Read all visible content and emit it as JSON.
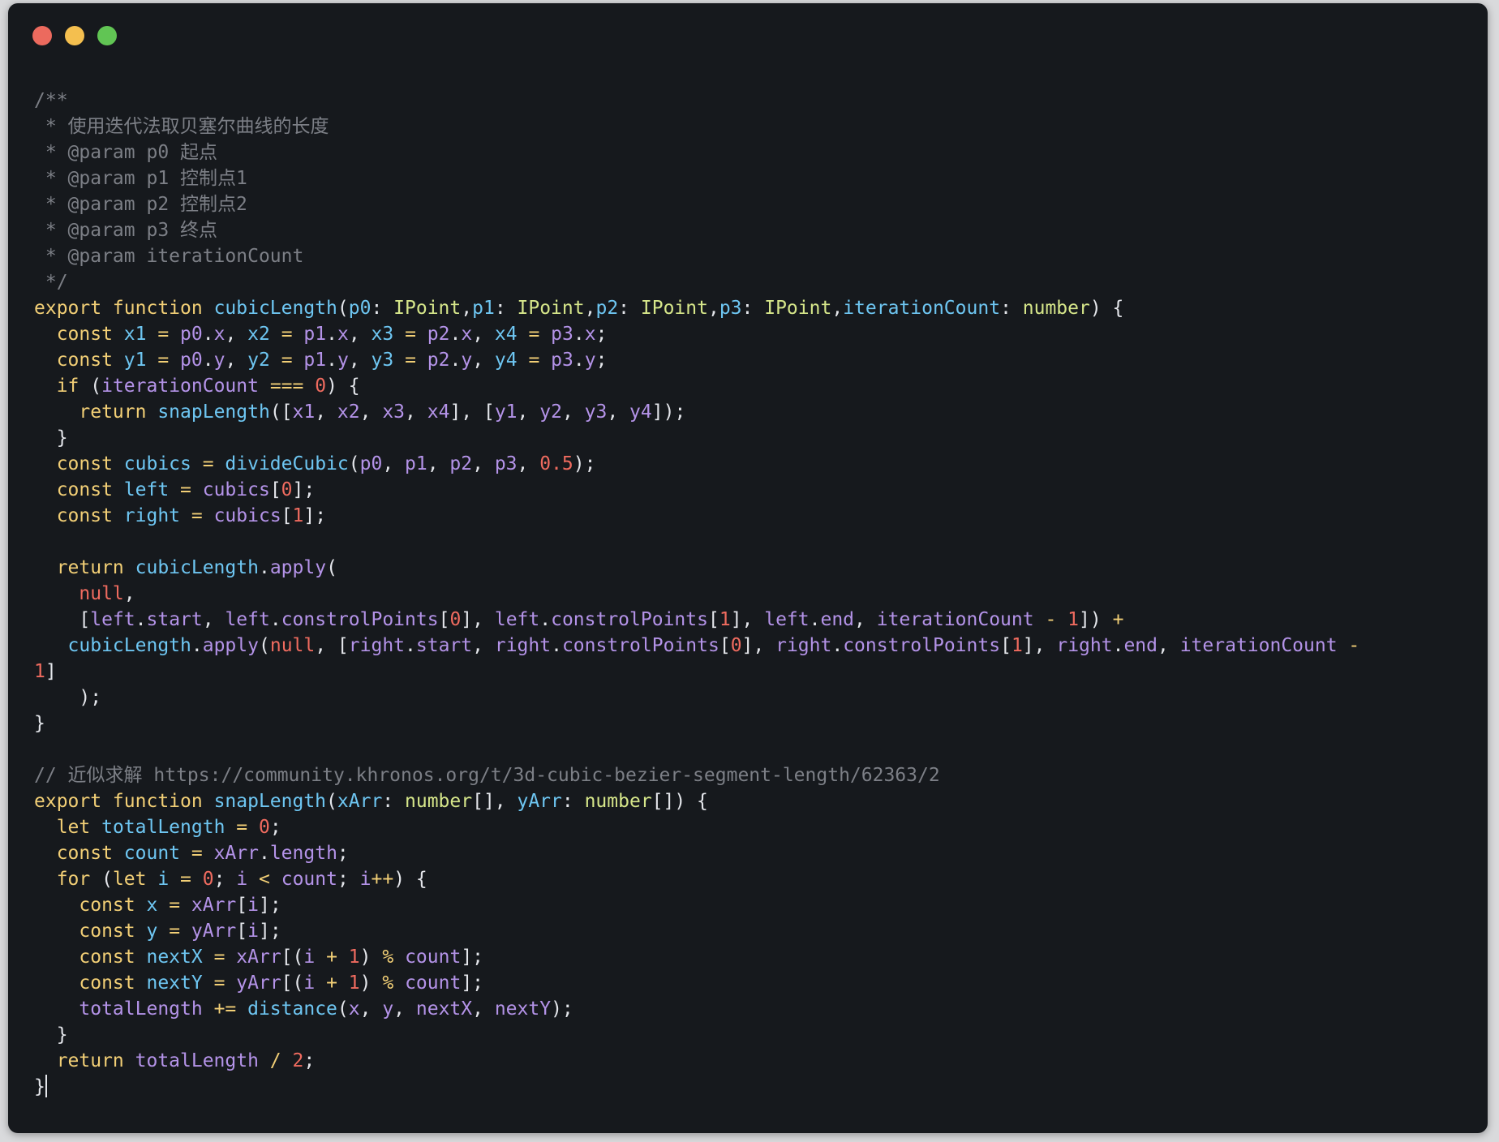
{
  "window": {
    "controls": {
      "close_color": "#ec6a5e",
      "minimize_color": "#f4bf4f",
      "zoom_color": "#61c554"
    }
  },
  "code_lines": [
    [
      {
        "t": "/**",
        "c": "cm"
      }
    ],
    [
      {
        "t": " * 使用迭代法取贝塞尔曲线的长度",
        "c": "cm"
      }
    ],
    [
      {
        "t": " * @param p0 起点",
        "c": "cm"
      }
    ],
    [
      {
        "t": " * @param p1 控制点1",
        "c": "cm"
      }
    ],
    [
      {
        "t": " * @param p2 控制点2",
        "c": "cm"
      }
    ],
    [
      {
        "t": " * @param p3 终点",
        "c": "cm"
      }
    ],
    [
      {
        "t": " * @param iterationCount",
        "c": "cm"
      }
    ],
    [
      {
        "t": " */",
        "c": "cm"
      }
    ],
    [
      {
        "t": "export function ",
        "c": "kw"
      },
      {
        "t": "cubicLength",
        "c": "fn"
      },
      {
        "t": "(",
        "c": "op"
      },
      {
        "t": "p0",
        "c": "fn"
      },
      {
        "t": ": ",
        "c": "op"
      },
      {
        "t": "IPoint",
        "c": "ty"
      },
      {
        "t": ",",
        "c": "op"
      },
      {
        "t": "p1",
        "c": "fn"
      },
      {
        "t": ": ",
        "c": "op"
      },
      {
        "t": "IPoint",
        "c": "ty"
      },
      {
        "t": ",",
        "c": "op"
      },
      {
        "t": "p2",
        "c": "fn"
      },
      {
        "t": ": ",
        "c": "op"
      },
      {
        "t": "IPoint",
        "c": "ty"
      },
      {
        "t": ",",
        "c": "op"
      },
      {
        "t": "p3",
        "c": "fn"
      },
      {
        "t": ": ",
        "c": "op"
      },
      {
        "t": "IPoint",
        "c": "ty"
      },
      {
        "t": ",",
        "c": "op"
      },
      {
        "t": "iterationCount",
        "c": "fn"
      },
      {
        "t": ": ",
        "c": "op"
      },
      {
        "t": "number",
        "c": "ty"
      },
      {
        "t": ") {",
        "c": "op"
      }
    ],
    [
      {
        "t": "  const ",
        "c": "kw"
      },
      {
        "t": "x1",
        "c": "fn"
      },
      {
        "t": " = ",
        "c": "kw"
      },
      {
        "t": "p0",
        "c": "vr"
      },
      {
        "t": ".",
        "c": "op"
      },
      {
        "t": "x",
        "c": "vr"
      },
      {
        "t": ", ",
        "c": "op"
      },
      {
        "t": "x2",
        "c": "fn"
      },
      {
        "t": " = ",
        "c": "kw"
      },
      {
        "t": "p1",
        "c": "vr"
      },
      {
        "t": ".",
        "c": "op"
      },
      {
        "t": "x",
        "c": "vr"
      },
      {
        "t": ", ",
        "c": "op"
      },
      {
        "t": "x3",
        "c": "fn"
      },
      {
        "t": " = ",
        "c": "kw"
      },
      {
        "t": "p2",
        "c": "vr"
      },
      {
        "t": ".",
        "c": "op"
      },
      {
        "t": "x",
        "c": "vr"
      },
      {
        "t": ", ",
        "c": "op"
      },
      {
        "t": "x4",
        "c": "fn"
      },
      {
        "t": " = ",
        "c": "kw"
      },
      {
        "t": "p3",
        "c": "vr"
      },
      {
        "t": ".",
        "c": "op"
      },
      {
        "t": "x",
        "c": "vr"
      },
      {
        "t": ";",
        "c": "op"
      }
    ],
    [
      {
        "t": "  const ",
        "c": "kw"
      },
      {
        "t": "y1",
        "c": "fn"
      },
      {
        "t": " = ",
        "c": "kw"
      },
      {
        "t": "p0",
        "c": "vr"
      },
      {
        "t": ".",
        "c": "op"
      },
      {
        "t": "y",
        "c": "vr"
      },
      {
        "t": ", ",
        "c": "op"
      },
      {
        "t": "y2",
        "c": "fn"
      },
      {
        "t": " = ",
        "c": "kw"
      },
      {
        "t": "p1",
        "c": "vr"
      },
      {
        "t": ".",
        "c": "op"
      },
      {
        "t": "y",
        "c": "vr"
      },
      {
        "t": ", ",
        "c": "op"
      },
      {
        "t": "y3",
        "c": "fn"
      },
      {
        "t": " = ",
        "c": "kw"
      },
      {
        "t": "p2",
        "c": "vr"
      },
      {
        "t": ".",
        "c": "op"
      },
      {
        "t": "y",
        "c": "vr"
      },
      {
        "t": ", ",
        "c": "op"
      },
      {
        "t": "y4",
        "c": "fn"
      },
      {
        "t": " = ",
        "c": "kw"
      },
      {
        "t": "p3",
        "c": "vr"
      },
      {
        "t": ".",
        "c": "op"
      },
      {
        "t": "y",
        "c": "vr"
      },
      {
        "t": ";",
        "c": "op"
      }
    ],
    [
      {
        "t": "  if ",
        "c": "kw"
      },
      {
        "t": "(",
        "c": "op"
      },
      {
        "t": "iterationCount",
        "c": "vr"
      },
      {
        "t": " === ",
        "c": "kw"
      },
      {
        "t": "0",
        "c": "nm"
      },
      {
        "t": ") {",
        "c": "op"
      }
    ],
    [
      {
        "t": "    return ",
        "c": "kw"
      },
      {
        "t": "snapLength",
        "c": "fn"
      },
      {
        "t": "([",
        "c": "op"
      },
      {
        "t": "x1",
        "c": "vr"
      },
      {
        "t": ", ",
        "c": "op"
      },
      {
        "t": "x2",
        "c": "vr"
      },
      {
        "t": ", ",
        "c": "op"
      },
      {
        "t": "x3",
        "c": "vr"
      },
      {
        "t": ", ",
        "c": "op"
      },
      {
        "t": "x4",
        "c": "vr"
      },
      {
        "t": "], [",
        "c": "op"
      },
      {
        "t": "y1",
        "c": "vr"
      },
      {
        "t": ", ",
        "c": "op"
      },
      {
        "t": "y2",
        "c": "vr"
      },
      {
        "t": ", ",
        "c": "op"
      },
      {
        "t": "y3",
        "c": "vr"
      },
      {
        "t": ", ",
        "c": "op"
      },
      {
        "t": "y4",
        "c": "vr"
      },
      {
        "t": "]);",
        "c": "op"
      }
    ],
    [
      {
        "t": "  }",
        "c": "op"
      }
    ],
    [
      {
        "t": "  const ",
        "c": "kw"
      },
      {
        "t": "cubics",
        "c": "fn"
      },
      {
        "t": " = ",
        "c": "kw"
      },
      {
        "t": "divideCubic",
        "c": "fn"
      },
      {
        "t": "(",
        "c": "op"
      },
      {
        "t": "p0",
        "c": "vr"
      },
      {
        "t": ", ",
        "c": "op"
      },
      {
        "t": "p1",
        "c": "vr"
      },
      {
        "t": ", ",
        "c": "op"
      },
      {
        "t": "p2",
        "c": "vr"
      },
      {
        "t": ", ",
        "c": "op"
      },
      {
        "t": "p3",
        "c": "vr"
      },
      {
        "t": ", ",
        "c": "op"
      },
      {
        "t": "0.5",
        "c": "nm"
      },
      {
        "t": ");",
        "c": "op"
      }
    ],
    [
      {
        "t": "  const ",
        "c": "kw"
      },
      {
        "t": "left",
        "c": "fn"
      },
      {
        "t": " = ",
        "c": "kw"
      },
      {
        "t": "cubics",
        "c": "vr"
      },
      {
        "t": "[",
        "c": "op"
      },
      {
        "t": "0",
        "c": "nm"
      },
      {
        "t": "];",
        "c": "op"
      }
    ],
    [
      {
        "t": "  const ",
        "c": "kw"
      },
      {
        "t": "right",
        "c": "fn"
      },
      {
        "t": " = ",
        "c": "kw"
      },
      {
        "t": "cubics",
        "c": "vr"
      },
      {
        "t": "[",
        "c": "op"
      },
      {
        "t": "1",
        "c": "nm"
      },
      {
        "t": "];",
        "c": "op"
      }
    ],
    [],
    [
      {
        "t": "  return ",
        "c": "kw"
      },
      {
        "t": "cubicLength",
        "c": "fn"
      },
      {
        "t": ".",
        "c": "op"
      },
      {
        "t": "apply",
        "c": "vr"
      },
      {
        "t": "(",
        "c": "op"
      }
    ],
    [
      {
        "t": "    null",
        "c": "nm"
      },
      {
        "t": ",",
        "c": "op"
      }
    ],
    [
      {
        "t": "    [",
        "c": "op"
      },
      {
        "t": "left",
        "c": "vr"
      },
      {
        "t": ".",
        "c": "op"
      },
      {
        "t": "start",
        "c": "vr"
      },
      {
        "t": ", ",
        "c": "op"
      },
      {
        "t": "left",
        "c": "vr"
      },
      {
        "t": ".",
        "c": "op"
      },
      {
        "t": "constrolPoints",
        "c": "vr"
      },
      {
        "t": "[",
        "c": "op"
      },
      {
        "t": "0",
        "c": "nm"
      },
      {
        "t": "], ",
        "c": "op"
      },
      {
        "t": "left",
        "c": "vr"
      },
      {
        "t": ".",
        "c": "op"
      },
      {
        "t": "constrolPoints",
        "c": "vr"
      },
      {
        "t": "[",
        "c": "op"
      },
      {
        "t": "1",
        "c": "nm"
      },
      {
        "t": "], ",
        "c": "op"
      },
      {
        "t": "left",
        "c": "vr"
      },
      {
        "t": ".",
        "c": "op"
      },
      {
        "t": "end",
        "c": "vr"
      },
      {
        "t": ", ",
        "c": "op"
      },
      {
        "t": "iterationCount",
        "c": "vr"
      },
      {
        "t": " - ",
        "c": "kw"
      },
      {
        "t": "1",
        "c": "nm"
      },
      {
        "t": "]) ",
        "c": "op"
      },
      {
        "t": "+",
        "c": "kw"
      }
    ],
    [
      {
        "t": "   cubicLength",
        "c": "fn"
      },
      {
        "t": ".",
        "c": "op"
      },
      {
        "t": "apply",
        "c": "vr"
      },
      {
        "t": "(",
        "c": "op"
      },
      {
        "t": "null",
        "c": "nm"
      },
      {
        "t": ", [",
        "c": "op"
      },
      {
        "t": "right",
        "c": "vr"
      },
      {
        "t": ".",
        "c": "op"
      },
      {
        "t": "start",
        "c": "vr"
      },
      {
        "t": ", ",
        "c": "op"
      },
      {
        "t": "right",
        "c": "vr"
      },
      {
        "t": ".",
        "c": "op"
      },
      {
        "t": "constrolPoints",
        "c": "vr"
      },
      {
        "t": "[",
        "c": "op"
      },
      {
        "t": "0",
        "c": "nm"
      },
      {
        "t": "], ",
        "c": "op"
      },
      {
        "t": "right",
        "c": "vr"
      },
      {
        "t": ".",
        "c": "op"
      },
      {
        "t": "constrolPoints",
        "c": "vr"
      },
      {
        "t": "[",
        "c": "op"
      },
      {
        "t": "1",
        "c": "nm"
      },
      {
        "t": "], ",
        "c": "op"
      },
      {
        "t": "right",
        "c": "vr"
      },
      {
        "t": ".",
        "c": "op"
      },
      {
        "t": "end",
        "c": "vr"
      },
      {
        "t": ", ",
        "c": "op"
      },
      {
        "t": "iterationCount",
        "c": "vr"
      },
      {
        "t": " -",
        "c": "kw"
      }
    ],
    [
      {
        "t": "1",
        "c": "nm"
      },
      {
        "t": "]",
        "c": "op"
      }
    ],
    [
      {
        "t": "    );",
        "c": "op"
      }
    ],
    [
      {
        "t": "}",
        "c": "op"
      }
    ],
    [],
    [
      {
        "t": "// 近似求解 https://community.khronos.org/t/3d-cubic-bezier-segment-length/62363/2",
        "c": "cm"
      }
    ],
    [
      {
        "t": "export function ",
        "c": "kw"
      },
      {
        "t": "snapLength",
        "c": "fn"
      },
      {
        "t": "(",
        "c": "op"
      },
      {
        "t": "xArr",
        "c": "fn"
      },
      {
        "t": ": ",
        "c": "op"
      },
      {
        "t": "number",
        "c": "ty"
      },
      {
        "t": "[], ",
        "c": "op"
      },
      {
        "t": "yArr",
        "c": "fn"
      },
      {
        "t": ": ",
        "c": "op"
      },
      {
        "t": "number",
        "c": "ty"
      },
      {
        "t": "[]) {",
        "c": "op"
      }
    ],
    [
      {
        "t": "  let ",
        "c": "kw"
      },
      {
        "t": "totalLength",
        "c": "fn"
      },
      {
        "t": " = ",
        "c": "kw"
      },
      {
        "t": "0",
        "c": "nm"
      },
      {
        "t": ";",
        "c": "op"
      }
    ],
    [
      {
        "t": "  const ",
        "c": "kw"
      },
      {
        "t": "count",
        "c": "fn"
      },
      {
        "t": " = ",
        "c": "kw"
      },
      {
        "t": "xArr",
        "c": "vr"
      },
      {
        "t": ".",
        "c": "op"
      },
      {
        "t": "length",
        "c": "vr"
      },
      {
        "t": ";",
        "c": "op"
      }
    ],
    [
      {
        "t": "  for ",
        "c": "kw"
      },
      {
        "t": "(",
        "c": "op"
      },
      {
        "t": "let ",
        "c": "kw"
      },
      {
        "t": "i",
        "c": "fn"
      },
      {
        "t": " = ",
        "c": "kw"
      },
      {
        "t": "0",
        "c": "nm"
      },
      {
        "t": "; ",
        "c": "op"
      },
      {
        "t": "i",
        "c": "vr"
      },
      {
        "t": " < ",
        "c": "kw"
      },
      {
        "t": "count",
        "c": "vr"
      },
      {
        "t": "; ",
        "c": "op"
      },
      {
        "t": "i",
        "c": "vr"
      },
      {
        "t": "++",
        "c": "kw"
      },
      {
        "t": ") {",
        "c": "op"
      }
    ],
    [
      {
        "t": "    const ",
        "c": "kw"
      },
      {
        "t": "x",
        "c": "fn"
      },
      {
        "t": " = ",
        "c": "kw"
      },
      {
        "t": "xArr",
        "c": "vr"
      },
      {
        "t": "[",
        "c": "op"
      },
      {
        "t": "i",
        "c": "vr"
      },
      {
        "t": "];",
        "c": "op"
      }
    ],
    [
      {
        "t": "    const ",
        "c": "kw"
      },
      {
        "t": "y",
        "c": "fn"
      },
      {
        "t": " = ",
        "c": "kw"
      },
      {
        "t": "yArr",
        "c": "vr"
      },
      {
        "t": "[",
        "c": "op"
      },
      {
        "t": "i",
        "c": "vr"
      },
      {
        "t": "];",
        "c": "op"
      }
    ],
    [
      {
        "t": "    const ",
        "c": "kw"
      },
      {
        "t": "nextX",
        "c": "fn"
      },
      {
        "t": " = ",
        "c": "kw"
      },
      {
        "t": "xArr",
        "c": "vr"
      },
      {
        "t": "[(",
        "c": "op"
      },
      {
        "t": "i",
        "c": "vr"
      },
      {
        "t": " + ",
        "c": "kw"
      },
      {
        "t": "1",
        "c": "nm"
      },
      {
        "t": ") ",
        "c": "op"
      },
      {
        "t": "%",
        "c": "kw"
      },
      {
        "t": " ",
        "c": "op"
      },
      {
        "t": "count",
        "c": "vr"
      },
      {
        "t": "];",
        "c": "op"
      }
    ],
    [
      {
        "t": "    const ",
        "c": "kw"
      },
      {
        "t": "nextY",
        "c": "fn"
      },
      {
        "t": " = ",
        "c": "kw"
      },
      {
        "t": "yArr",
        "c": "vr"
      },
      {
        "t": "[(",
        "c": "op"
      },
      {
        "t": "i",
        "c": "vr"
      },
      {
        "t": " + ",
        "c": "kw"
      },
      {
        "t": "1",
        "c": "nm"
      },
      {
        "t": ") ",
        "c": "op"
      },
      {
        "t": "%",
        "c": "kw"
      },
      {
        "t": " ",
        "c": "op"
      },
      {
        "t": "count",
        "c": "vr"
      },
      {
        "t": "];",
        "c": "op"
      }
    ],
    [
      {
        "t": "    totalLength",
        "c": "vr"
      },
      {
        "t": " += ",
        "c": "kw"
      },
      {
        "t": "distance",
        "c": "fn"
      },
      {
        "t": "(",
        "c": "op"
      },
      {
        "t": "x",
        "c": "vr"
      },
      {
        "t": ", ",
        "c": "op"
      },
      {
        "t": "y",
        "c": "vr"
      },
      {
        "t": ", ",
        "c": "op"
      },
      {
        "t": "nextX",
        "c": "vr"
      },
      {
        "t": ", ",
        "c": "op"
      },
      {
        "t": "nextY",
        "c": "vr"
      },
      {
        "t": ");",
        "c": "op"
      }
    ],
    [
      {
        "t": "  }",
        "c": "op"
      }
    ],
    [
      {
        "t": "  return ",
        "c": "kw"
      },
      {
        "t": "totalLength",
        "c": "vr"
      },
      {
        "t": " / ",
        "c": "kw"
      },
      {
        "t": "2",
        "c": "nm"
      },
      {
        "t": ";",
        "c": "op"
      }
    ],
    [
      {
        "t": "}",
        "c": "op"
      }
    ]
  ]
}
